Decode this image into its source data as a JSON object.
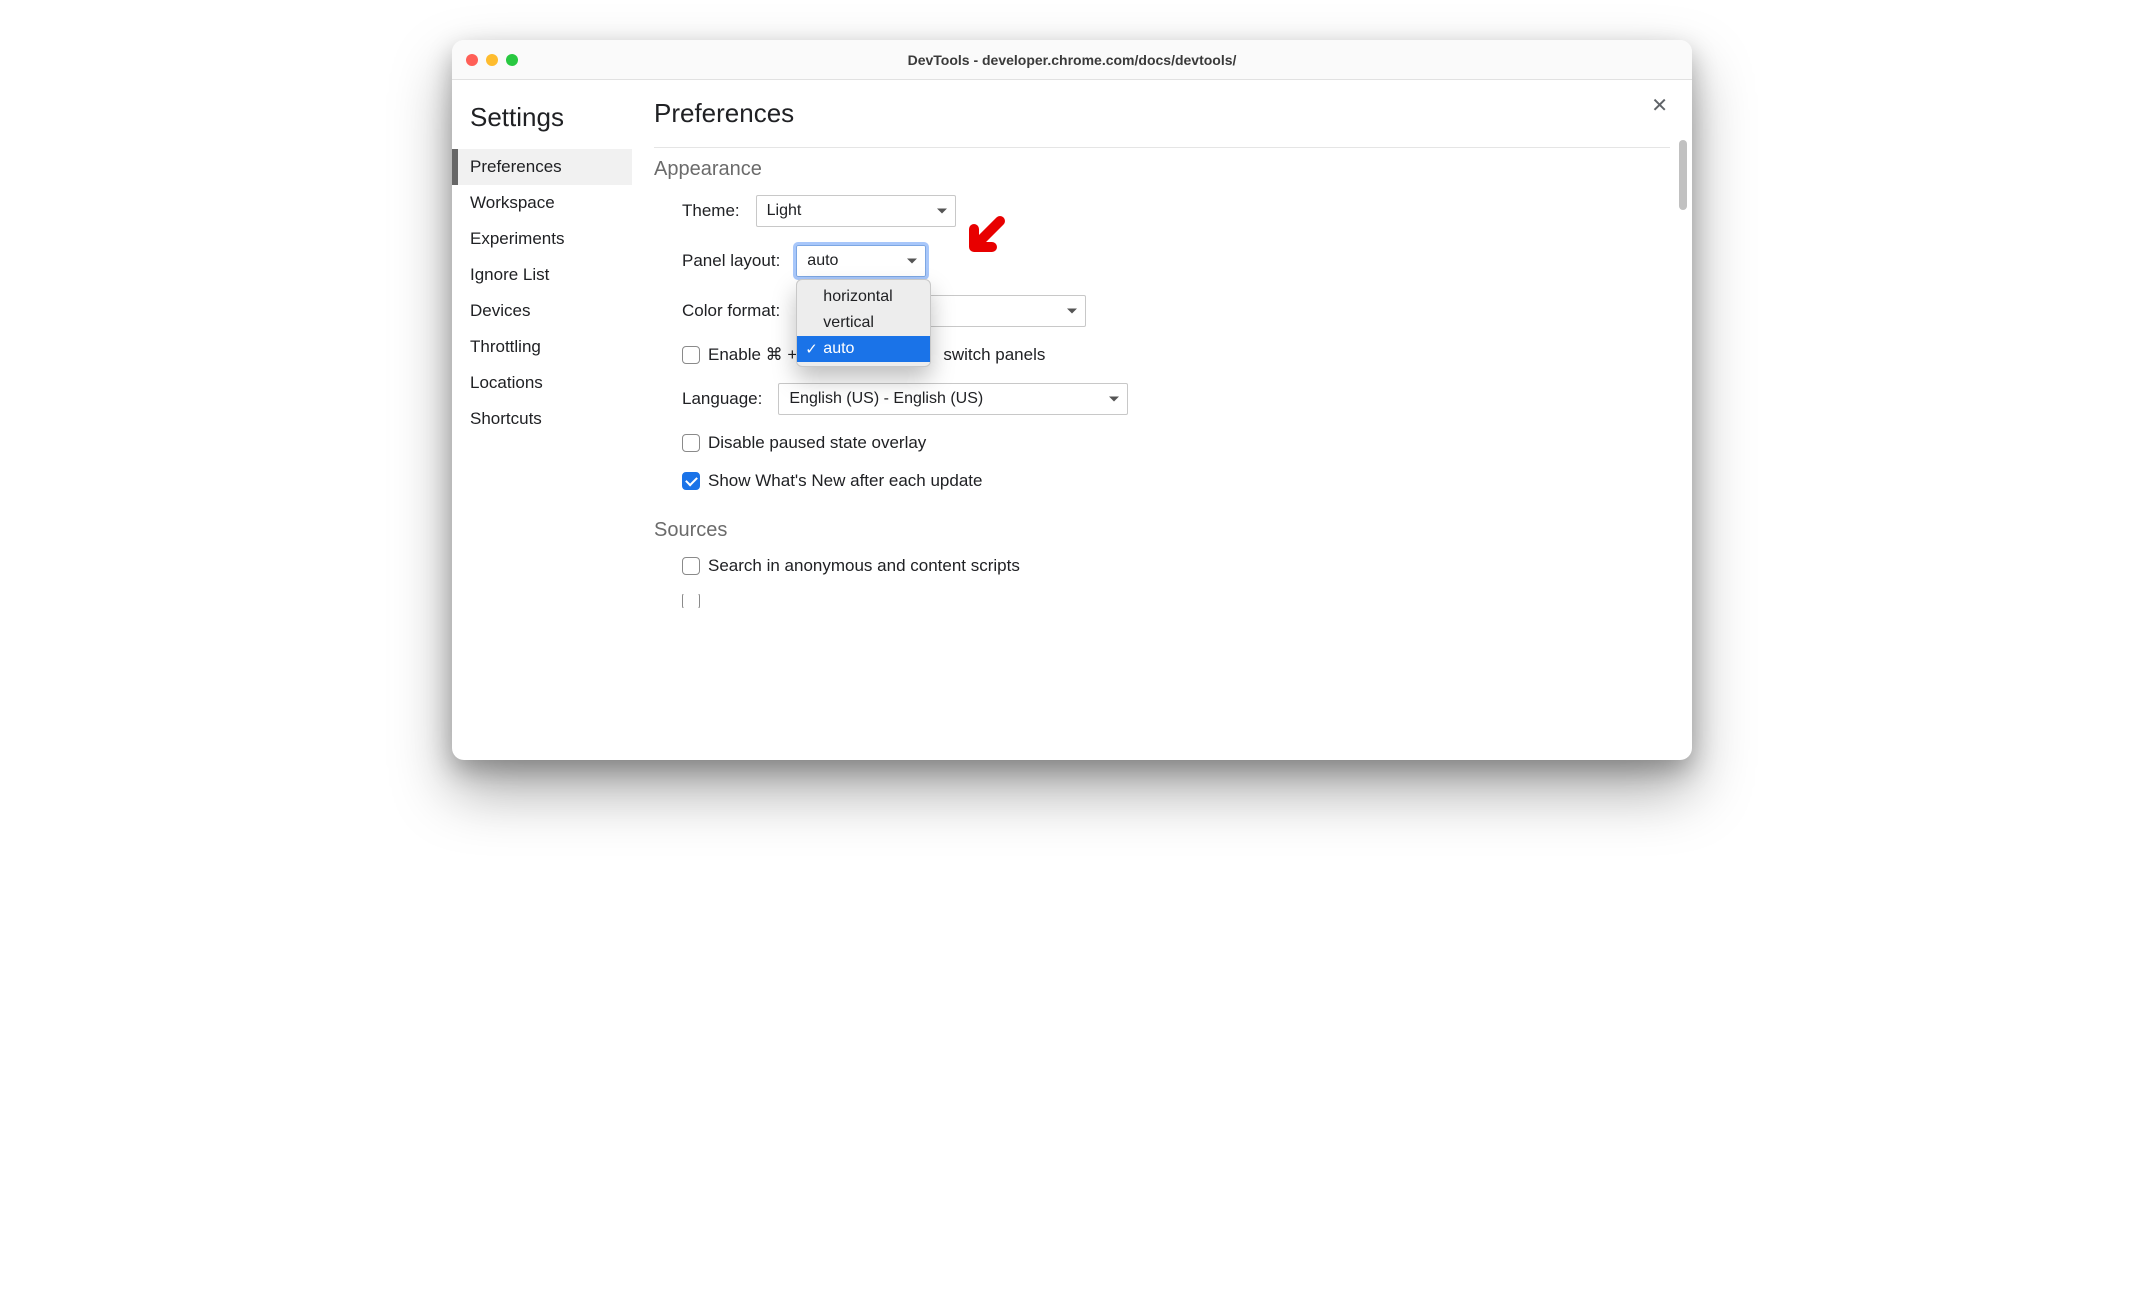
{
  "window": {
    "title": "DevTools - developer.chrome.com/docs/devtools/"
  },
  "sidebar": {
    "heading": "Settings",
    "items": [
      {
        "label": "Preferences",
        "selected": true
      },
      {
        "label": "Workspace",
        "selected": false
      },
      {
        "label": "Experiments",
        "selected": false
      },
      {
        "label": "Ignore List",
        "selected": false
      },
      {
        "label": "Devices",
        "selected": false
      },
      {
        "label": "Throttling",
        "selected": false
      },
      {
        "label": "Locations",
        "selected": false
      },
      {
        "label": "Shortcuts",
        "selected": false
      }
    ]
  },
  "page": {
    "title": "Preferences"
  },
  "sections": {
    "appearance": {
      "title": "Appearance",
      "theme_label": "Theme:",
      "theme_value": "Light",
      "panel_label": "Panel layout:",
      "panel_value": "auto",
      "panel_options": [
        {
          "label": "horizontal",
          "selected": false
        },
        {
          "label": "vertical",
          "selected": false
        },
        {
          "label": "auto",
          "selected": true
        }
      ],
      "color_label": "Color format:",
      "color_value": "",
      "shortcut_before": "Enable ⌘ + ",
      "shortcut_after": " switch panels",
      "shortcut_checked": false,
      "lang_label": "Language:",
      "lang_value": "English (US) - English (US)",
      "pause_overlay_label": "Disable paused state overlay",
      "pause_overlay_checked": false,
      "whats_new_label": "Show What's New after each update",
      "whats_new_checked": true
    },
    "sources": {
      "title": "Sources",
      "search_anon_label": "Search in anonymous and content scripts",
      "search_anon_checked": false
    }
  },
  "annotation": {
    "name": "red-arrow"
  }
}
